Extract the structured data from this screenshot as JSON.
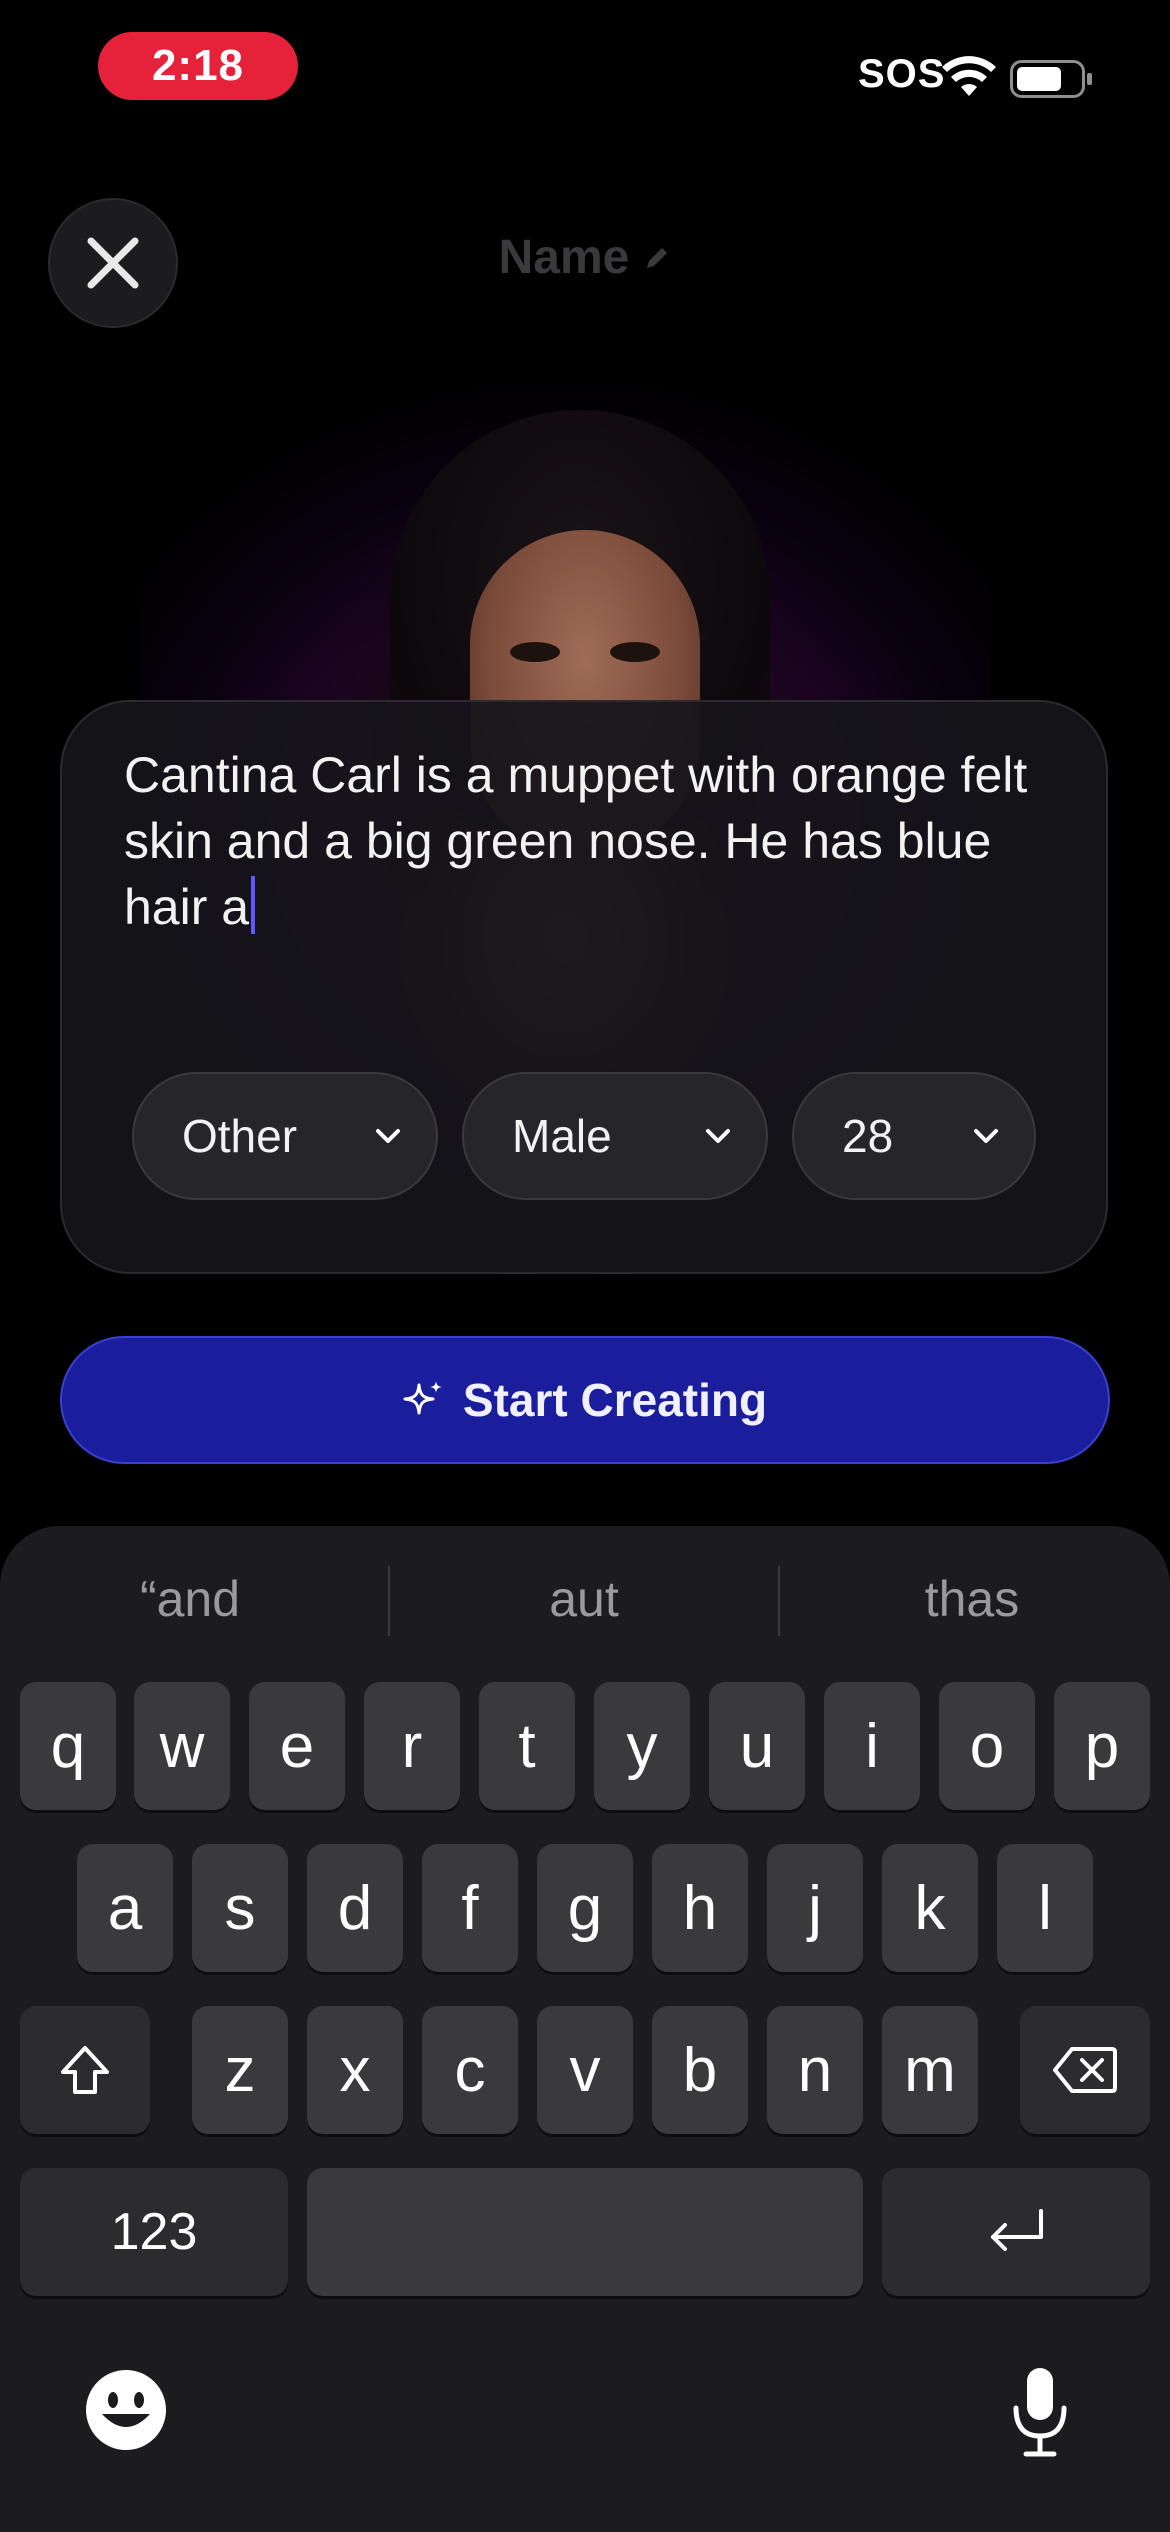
{
  "status_bar": {
    "time": "2:18",
    "sos": "SOS"
  },
  "header": {
    "title": "Name"
  },
  "prompt": {
    "text": "Cantina Carl is a muppet with orange felt skin and a big green nose. He has blue hair a"
  },
  "selectors": [
    {
      "label": "Other"
    },
    {
      "label": "Male"
    },
    {
      "label": "28"
    }
  ],
  "start_button": {
    "label": "Start Creating"
  },
  "keyboard": {
    "suggestions": [
      "“and",
      "aut",
      "thas"
    ],
    "row1": [
      "q",
      "w",
      "e",
      "r",
      "t",
      "y",
      "u",
      "i",
      "o",
      "p"
    ],
    "row2": [
      "a",
      "s",
      "d",
      "f",
      "g",
      "h",
      "j",
      "k",
      "l"
    ],
    "row3": [
      "z",
      "x",
      "c",
      "v",
      "b",
      "n",
      "m"
    ],
    "numbers_label": "123"
  },
  "colors": {
    "accent": "#1a1e9c",
    "status_pill": "#e5223a",
    "cursor": "#5b5bff"
  }
}
